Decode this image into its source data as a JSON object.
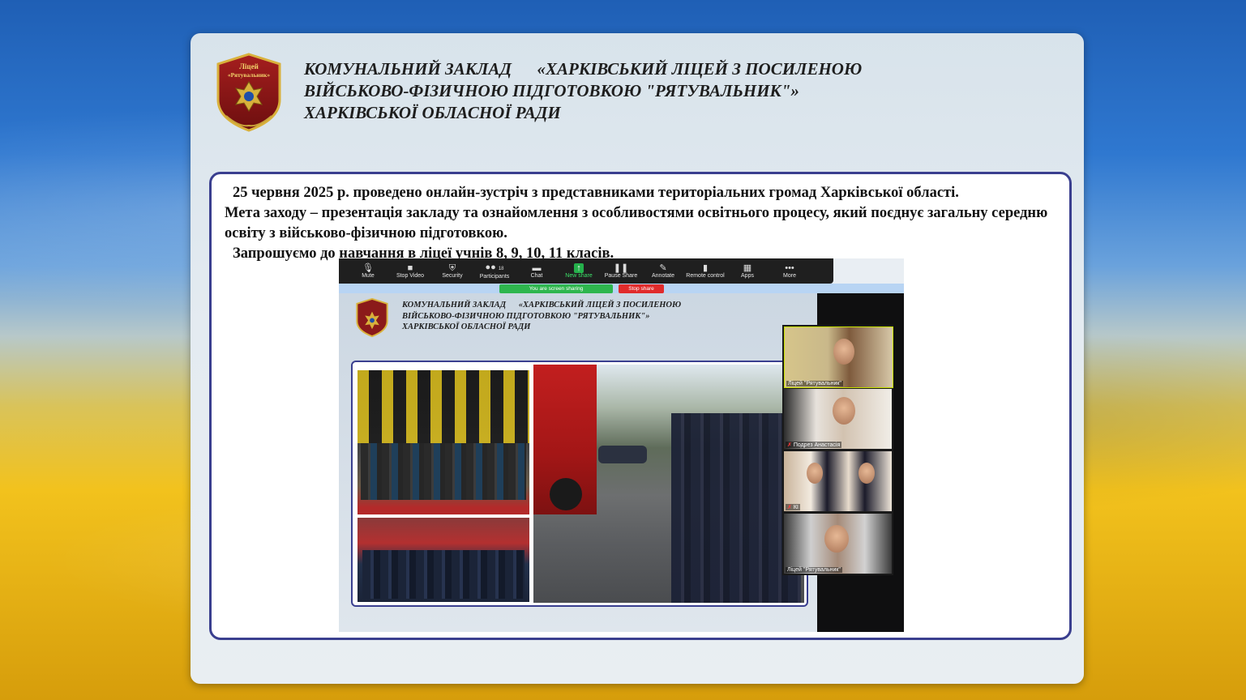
{
  "header": {
    "line1": "КОМУНАЛЬНИЙ ЗАКЛАД      «ХАРКІВСЬКИЙ ЛІЦЕЙ З ПОСИЛЕНОЮ",
    "line2": "ВІЙСЬКОВО-ФІЗИЧНОЮ ПІДГОТОВКОЮ \"РЯТУВАЛЬНИК\"»",
    "line3": "ХАРКІВСЬКОЇ ОБЛАСНОЇ РАДИ"
  },
  "logo": {
    "text": "Ліцей «Рятувальник»",
    "color": "#8b1a1a"
  },
  "body": {
    "p1": "25 червня 2025 р. проведено онлайн-зустріч з представниками територіальних громад Харківської області.",
    "p2": "Мета заходу – презентація закладу та ознайомлення з особливостями освітнього процесу, який поєднує загальну середню освіту з військово-фізичною підготовкою.",
    "p3": "Запрошуємо до навчання в ліцеї учнів 8, 9, 10, 11 класів."
  },
  "zoom": {
    "toolbar": [
      {
        "label": "Mute",
        "icon": "mic-icon",
        "glyph": "🎙"
      },
      {
        "label": "Stop Video",
        "icon": "video-icon",
        "glyph": "▶"
      },
      {
        "label": "Security",
        "icon": "shield-icon",
        "glyph": "⛨"
      },
      {
        "label": "Participants",
        "icon": "participants-icon",
        "glyph": "👥"
      },
      {
        "label": "Chat",
        "icon": "chat-icon",
        "glyph": "💬"
      },
      {
        "label": "New share",
        "icon": "share-icon",
        "glyph": "↑"
      },
      {
        "label": "Pause Share",
        "icon": "pause-icon",
        "glyph": "❚❚"
      },
      {
        "label": "Annotate",
        "icon": "pencil-icon",
        "glyph": "✎"
      },
      {
        "label": "Remote control",
        "icon": "remote-icon",
        "glyph": "🖱"
      },
      {
        "label": "Apps",
        "icon": "apps-icon",
        "glyph": "▦"
      },
      {
        "label": "More",
        "icon": "more-icon",
        "glyph": "•••"
      }
    ],
    "participants_count": "18",
    "sharing_label": "You are screen sharing",
    "stop_share_label": "Stop share",
    "participants": [
      {
        "name": "Ліцей \"Рятувальник\""
      },
      {
        "name": "Подрез Анастасія"
      },
      {
        "name": "КІ"
      },
      {
        "name": "Ліцей \"Рятувальник\""
      }
    ]
  }
}
